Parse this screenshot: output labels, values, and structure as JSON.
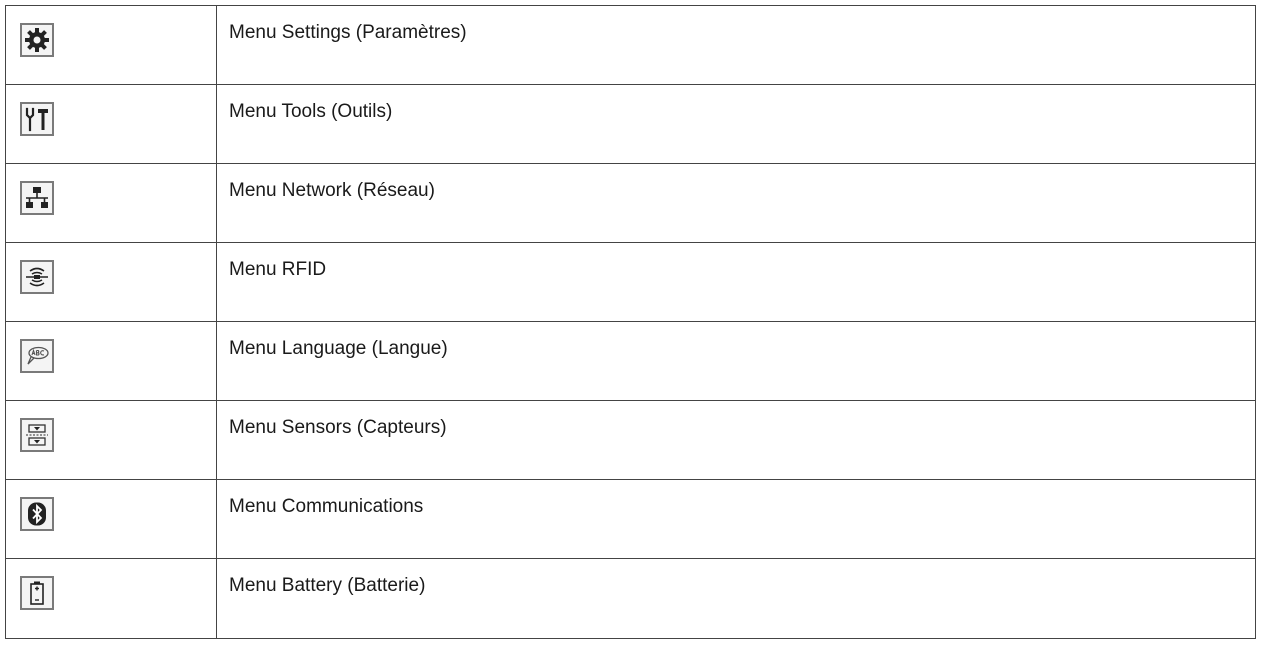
{
  "menu_items": [
    {
      "icon": "gear-icon",
      "label": "Menu Settings (Paramètres)"
    },
    {
      "icon": "tools-icon",
      "label": "Menu Tools (Outils)"
    },
    {
      "icon": "network-icon",
      "label": "Menu Network (Réseau)"
    },
    {
      "icon": "rfid-icon",
      "label": "Menu RFID"
    },
    {
      "icon": "language-icon",
      "label": "Menu Language (Langue)"
    },
    {
      "icon": "sensors-icon",
      "label": "Menu Sensors (Capteurs)"
    },
    {
      "icon": "bluetooth-icon",
      "label": "Menu Communications"
    },
    {
      "icon": "battery-icon",
      "label": "Menu Battery (Batterie)"
    }
  ],
  "colors": {
    "border": "#444444",
    "icon_frame": "#7a7a7a",
    "icon_fill": "#222222"
  }
}
